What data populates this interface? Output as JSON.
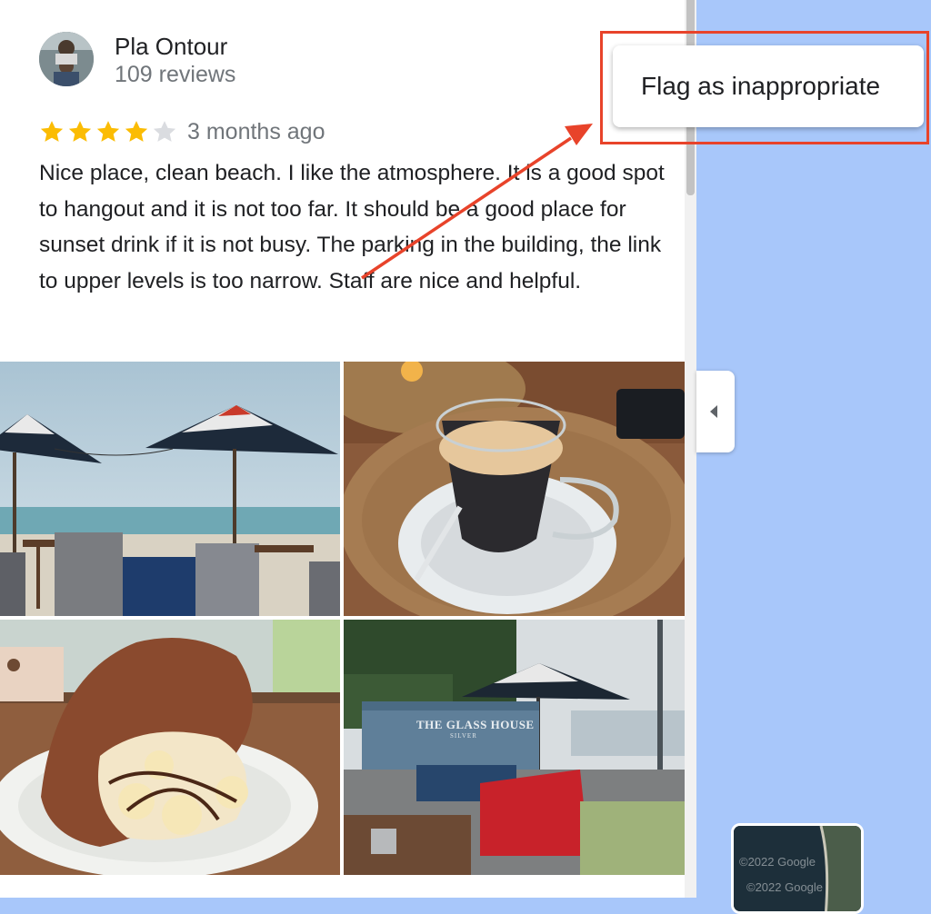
{
  "review": {
    "reviewer_name": "Pla Ontour",
    "review_count": "109 reviews",
    "rating": 4,
    "max_rating": 5,
    "time_ago": "3 months ago",
    "text": "Nice place, clean beach. I like the atmosphere. It is a good spot to hangout and it is not too far. It should be a good place for sunset drink if it is not busy. The parking in the building, the link to upper levels is too narrow. Staff are nice and helpful.",
    "photos": [
      {
        "name": "photo-beach-umbrellas"
      },
      {
        "name": "photo-coffee-glass"
      },
      {
        "name": "photo-crepe-dessert"
      },
      {
        "name": "photo-glass-house-sign"
      }
    ]
  },
  "menu": {
    "flag_label": "Flag as inappropriate"
  },
  "map_thumb": {
    "credit_1": "©2022 Google",
    "credit_2": "©2022 Google"
  },
  "colors": {
    "map_bg": "#a8c7fa",
    "star_filled": "#fbbc04",
    "star_empty": "#dadce0",
    "annotation_red": "#e8432a"
  },
  "icons": {
    "star": "star-icon",
    "collapse": "chevron-left-icon"
  }
}
